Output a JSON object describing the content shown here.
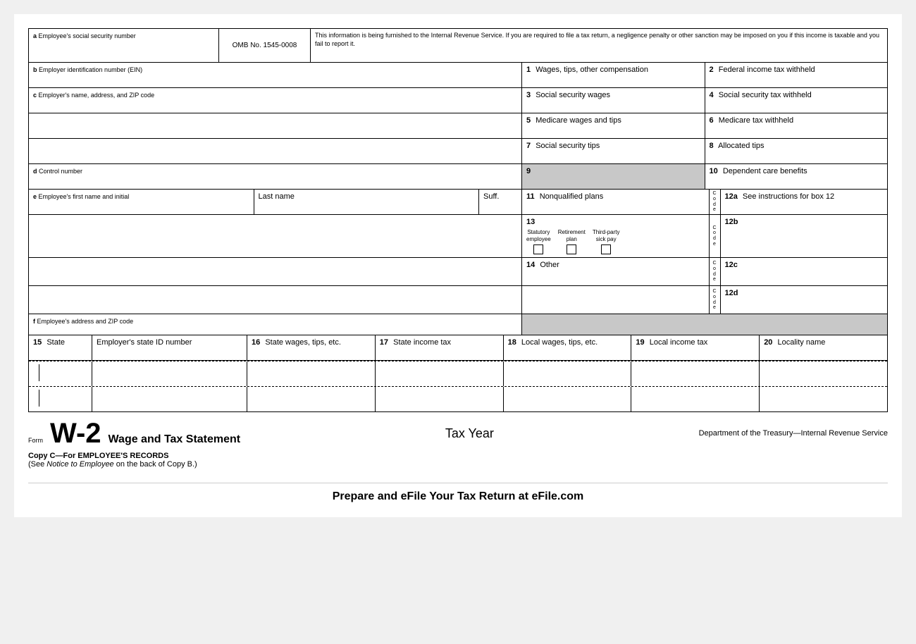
{
  "form": {
    "title": "W-2",
    "subtitle": "Wage and Tax Statement",
    "tax_year_label": "Tax Year",
    "irs_info": "Department of the Treasury—Internal Revenue Service",
    "copy_title": "Copy C—For EMPLOYEE'S RECORDS",
    "copy_subtitle": "(See Notice to Employee on the back of Copy B.)",
    "efile_banner": "Prepare and eFile Your Tax Return at eFile.com",
    "omb": "OMB No. 1545-0008",
    "irs_notice": "This information is being furnished to the Internal Revenue Service. If you are required to file a tax return, a negligence penalty or other sanction may be imposed on you if this income is taxable and you fail to report it."
  },
  "fields": {
    "a_label": "a",
    "a_name": "Employee's social security number",
    "b_label": "b",
    "b_name": "Employer identification number (EIN)",
    "c_label": "c",
    "c_name": "Employer's name, address, and ZIP code",
    "d_label": "d",
    "d_name": "Control number",
    "e_label": "e",
    "e_name": "Employee's first name and initial",
    "e_last": "Last name",
    "e_suff": "Suff.",
    "f_label": "f",
    "f_name": "Employee's address and ZIP code",
    "box1_num": "1",
    "box1_name": "Wages, tips, other compensation",
    "box2_num": "2",
    "box2_name": "Federal income tax withheld",
    "box3_num": "3",
    "box3_name": "Social security wages",
    "box4_num": "4",
    "box4_name": "Social security tax withheld",
    "box5_num": "5",
    "box5_name": "Medicare wages and tips",
    "box6_num": "6",
    "box6_name": "Medicare tax withheld",
    "box7_num": "7",
    "box7_name": "Social security tips",
    "box8_num": "8",
    "box8_name": "Allocated tips",
    "box9_num": "9",
    "box10_num": "10",
    "box10_name": "Dependent care benefits",
    "box11_num": "11",
    "box11_name": "Nonqualified plans",
    "box12a_num": "12a",
    "box12a_name": "See instructions for box 12",
    "box12a_code_label": "C\no\nd\ne",
    "box12b_num": "12b",
    "box12b_code_label": "C\no\nd\ne",
    "box12c_num": "12c",
    "box12c_code_label": "C\no\nd\ne",
    "box12d_num": "12d",
    "box12d_code_label": "C\no\nd\ne",
    "box13_num": "13",
    "box13_statutory": "Statutory\nemployee",
    "box13_retirement": "Retirement\nplan",
    "box13_thirdparty": "Third-party\nsick pay",
    "box14_num": "14",
    "box14_name": "Other",
    "box15_num": "15",
    "box15_state": "State",
    "box15_employer_state_id": "Employer's state ID number",
    "box16_num": "16",
    "box16_name": "State wages, tips, etc.",
    "box17_num": "17",
    "box17_name": "State income tax",
    "box18_num": "18",
    "box18_name": "Local wages, tips, etc.",
    "box19_num": "19",
    "box19_name": "Local income tax",
    "box20_num": "20",
    "box20_name": "Locality name"
  }
}
